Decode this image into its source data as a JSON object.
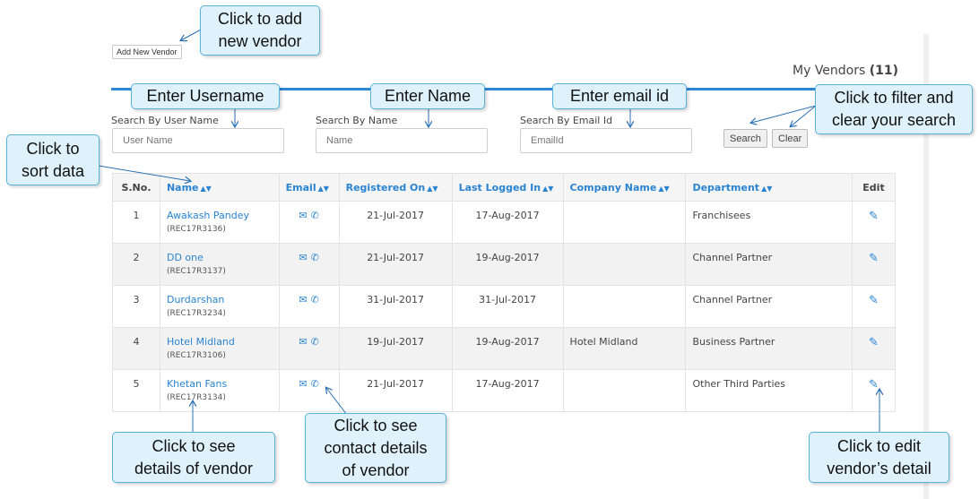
{
  "toolbar": {
    "add_vendor_label": "Add New Vendor"
  },
  "header": {
    "title": "My Vendors",
    "count": "(11)"
  },
  "filters": {
    "username": {
      "label": "Search By User Name",
      "placeholder": "User Name"
    },
    "name": {
      "label": "Search By Name",
      "placeholder": "Name"
    },
    "email": {
      "label": "Search By Email Id",
      "placeholder": "EmailId"
    },
    "search_label": "Search",
    "clear_label": "Clear"
  },
  "table": {
    "headers": {
      "sno": "S.No.",
      "name": "Name",
      "email": "Email",
      "registered": "Registered On",
      "last_login": "Last Logged In",
      "company": "Company Name",
      "department": "Department",
      "edit": "Edit"
    },
    "rows": [
      {
        "sno": "1",
        "name": "Awakash Pandey",
        "code": "(REC17R3136)",
        "registered": "21-Jul-2017",
        "last_login": "17-Aug-2017",
        "company": "",
        "department": "Franchisees"
      },
      {
        "sno": "2",
        "name": "DD one",
        "code": "(REC17R3137)",
        "registered": "21-Jul-2017",
        "last_login": "19-Aug-2017",
        "company": "",
        "department": "Channel Partner"
      },
      {
        "sno": "3",
        "name": "Durdarshan",
        "code": "(REC17R3234)",
        "registered": "31-Jul-2017",
        "last_login": "31-Jul-2017",
        "company": "",
        "department": "Channel Partner"
      },
      {
        "sno": "4",
        "name": "Hotel Midland",
        "code": "(REC17R3106)",
        "registered": "19-Jul-2017",
        "last_login": "19-Aug-2017",
        "company": "Hotel Midland",
        "department": "Business Partner"
      },
      {
        "sno": "5",
        "name": "Khetan Fans",
        "code": "(REC17R3134)",
        "registered": "21-Jul-2017",
        "last_login": "17-Aug-2017",
        "company": "",
        "department": "Other Third Parties"
      }
    ]
  },
  "callouts": {
    "add_vendor": {
      "line1": "Click to add",
      "line2": "new vendor"
    },
    "username": {
      "line1": "Enter Username"
    },
    "name": {
      "line1": "Enter Name"
    },
    "email": {
      "line1": "Enter email id"
    },
    "filter": {
      "line1": "Click to filter and",
      "line2": "clear your search"
    },
    "sort": {
      "line1": "Click to",
      "line2": "sort data"
    },
    "details": {
      "line1": "Click to see",
      "line2": "details of vendor"
    },
    "contact": {
      "line1": "Click to see",
      "line2": "contact details",
      "line3": "of vendor"
    },
    "edit": {
      "line1": "Click to edit",
      "line2": "vendor’s detail"
    }
  },
  "icons": {
    "sort": "sort-icon",
    "email": "envelope-icon",
    "phone": "phone-icon",
    "edit": "pencil-icon"
  },
  "colors": {
    "accent": "#2a84d2",
    "callout_bg": "#dff2fb",
    "callout_border": "#55b3dd"
  }
}
